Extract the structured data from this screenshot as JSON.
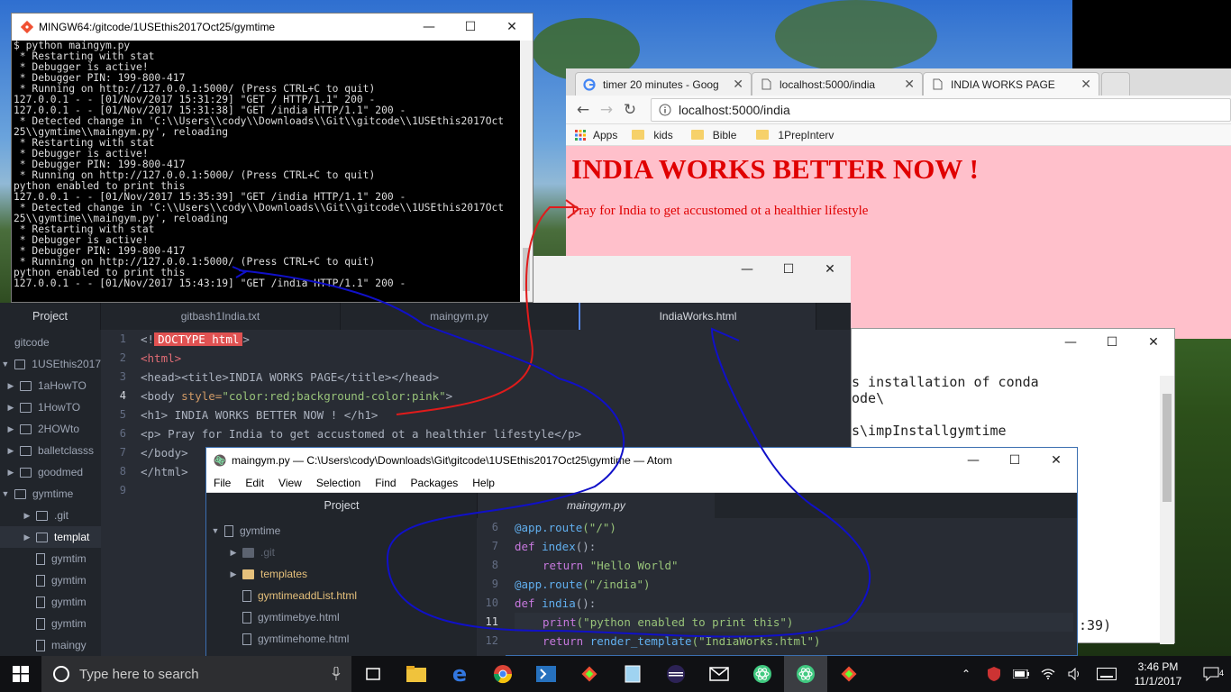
{
  "terminal": {
    "title": "MINGW64:/gitcode/1USEthis2017Oct25/gymtime",
    "lines": [
      "$ python maingym.py",
      " * Restarting with stat",
      " * Debugger is active!",
      " * Debugger PIN: 199-800-417",
      " * Running on http://127.0.0.1:5000/ (Press CTRL+C to quit)",
      "127.0.0.1 - - [01/Nov/2017 15:31:29] \"GET / HTTP/1.1\" 200 -",
      "127.0.0.1 - - [01/Nov/2017 15:31:38] \"GET /india HTTP/1.1\" 200 -",
      " * Detected change in 'C:\\\\Users\\\\cody\\\\Downloads\\\\Git\\\\gitcode\\\\1USEthis2017Oct",
      "25\\\\gymtime\\\\maingym.py', reloading",
      " * Restarting with stat",
      " * Debugger is active!",
      " * Debugger PIN: 199-800-417",
      " * Running on http://127.0.0.1:5000/ (Press CTRL+C to quit)",
      "python enabled to print this",
      "127.0.0.1 - - [01/Nov/2017 15:35:39] \"GET /india HTTP/1.1\" 200 -",
      " * Detected change in 'C:\\\\Users\\\\cody\\\\Downloads\\\\Git\\\\gitcode\\\\1USEthis2017Oct",
      "25\\\\gymtime\\\\maingym.py', reloading",
      " * Restarting with stat",
      " * Debugger is active!",
      " * Debugger PIN: 199-800-417",
      " * Running on http://127.0.0.1:5000/ (Press CTRL+C to quit)",
      "python enabled to print this",
      "127.0.0.1 - - [01/Nov/2017 15:43:19] \"GET /india HTTP/1.1\" 200 -"
    ]
  },
  "chrome": {
    "tabs": [
      {
        "label": "timer 20 minutes - Goog",
        "favicon": "google-icon"
      },
      {
        "label": "localhost:5000/india",
        "favicon": "page-icon"
      },
      {
        "label": "INDIA WORKS PAGE",
        "favicon": "page-icon"
      }
    ],
    "url": "localhost:5000/india",
    "bookmarks": [
      "Apps",
      "kids",
      "Bible",
      "1PrepInterv"
    ],
    "page": {
      "heading": "INDIA WORKS BETTER NOW !",
      "paragraph": "Pray for India to get accustomed ot a healthier lifestyle",
      "text_color": "#e00000",
      "background": "#ffc0cb"
    }
  },
  "cmd": {
    "lines": [
      "s installation of conda",
      "ode\\",
      "",
      "s\\impInstallgymtime"
    ],
    "trailing": ":39)"
  },
  "atom1": {
    "sidebar_title": "Project",
    "tabs": [
      "gitbash1India.txt",
      "maingym.py",
      "IndiaWorks.html"
    ],
    "tree": [
      {
        "label": "gitcode",
        "kind": "root"
      },
      {
        "label": "1USEthis2017",
        "kind": "folder-open"
      },
      {
        "label": "1aHowTO",
        "kind": "folder"
      },
      {
        "label": "1HowTO",
        "kind": "folder"
      },
      {
        "label": "2HOWto",
        "kind": "folder"
      },
      {
        "label": "balletclasss",
        "kind": "folder"
      },
      {
        "label": "goodmed",
        "kind": "folder"
      },
      {
        "label": "gymtime",
        "kind": "folder-open"
      },
      {
        "label": ".git",
        "kind": "subfolder"
      },
      {
        "label": "templat",
        "kind": "subfolder-sel"
      },
      {
        "label": "gymtim",
        "kind": "file"
      },
      {
        "label": "gymtim",
        "kind": "file"
      },
      {
        "label": "gymtim",
        "kind": "file"
      },
      {
        "label": "gymtim",
        "kind": "file"
      },
      {
        "label": "maingy",
        "kind": "file"
      }
    ],
    "line_numbers": [
      "1",
      "2",
      "3",
      "4",
      "5",
      "6",
      "7",
      "8",
      "9"
    ],
    "code": {
      "l1_pre": "<!",
      "l1_doctype": "DOCTYPE html",
      "l1_post": ">",
      "l2": "<html>",
      "l3": "<head><title>INDIA WORKS PAGE</title></head>",
      "l4_tag": "<body ",
      "l4_attr": "style=",
      "l4_str": "\"color:red;background-color:pink\"",
      "l4_end": ">",
      "l5": "<h1> INDIA WORKS BETTER NOW ! </h1>",
      "l6": "<p> Pray for India to get accustomed ot a healthier lifestyle</p>",
      "l7": "</body>",
      "l8": "</html>"
    }
  },
  "atom2": {
    "title": "maingym.py — C:\\Users\\cody\\Downloads\\Git\\gitcode\\1USEthis2017Oct25\\gymtime — Atom",
    "menu": [
      "File",
      "Edit",
      "View",
      "Selection",
      "Find",
      "Packages",
      "Help"
    ],
    "sidebar_title": "Project",
    "active_tab": "maingym.py",
    "tree": [
      {
        "label": "gymtime",
        "kind": "repo"
      },
      {
        "label": ".git",
        "kind": "folder"
      },
      {
        "label": "templates",
        "kind": "folder"
      },
      {
        "label": "gymtimeaddList.html",
        "kind": "file"
      },
      {
        "label": "gymtimebye.html",
        "kind": "file"
      },
      {
        "label": "gymtimehome.html",
        "kind": "file"
      }
    ],
    "line_numbers": [
      "6",
      "7",
      "8",
      "9",
      "10",
      "11",
      "12"
    ],
    "code": {
      "l6_dec": "@app.route",
      "l6_arg": "(\"/\")",
      "l7_kw": "def ",
      "l7_fn": "index",
      "l7_end": "():",
      "l8_kw": "return ",
      "l8_str": "\"Hello World\"",
      "l9_dec": "@app.route",
      "l9_arg": "(\"/india\")",
      "l10_kw": "def ",
      "l10_fn": "india",
      "l10_end": "():",
      "l11_fn": "print",
      "l11_str": "(\"python enabled to print this\")",
      "l12_kw": "return ",
      "l12_fn": "render_template",
      "l12_str": "(\"IndiaWorks.html\")"
    }
  },
  "taskbar": {
    "search_placeholder": "Type here to search",
    "time": "3:46 PM",
    "date": "11/1/2017",
    "notification_count": "4"
  }
}
